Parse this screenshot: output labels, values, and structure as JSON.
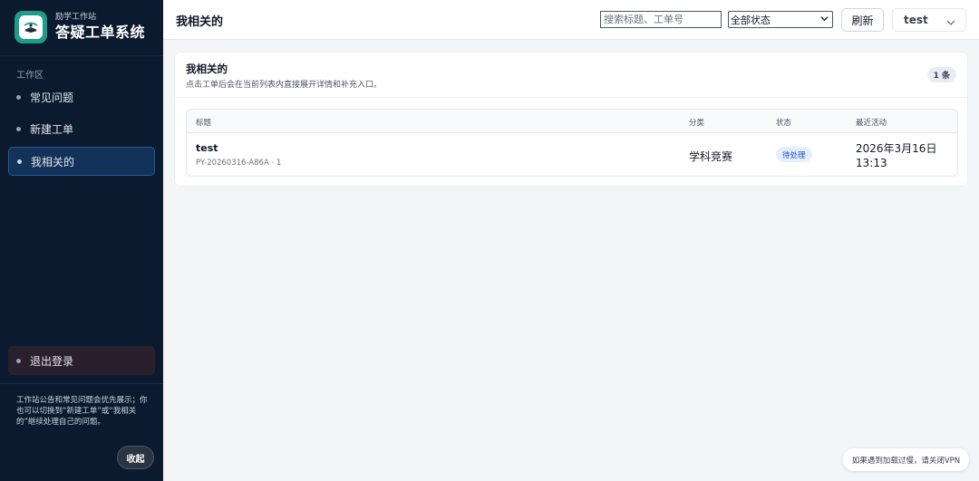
{
  "sidebar": {
    "brand_sub": "励学工作站",
    "brand_title": "答疑工单系统",
    "section_label": "工作区",
    "items": [
      {
        "label": "常见问题"
      },
      {
        "label": "新建工单"
      },
      {
        "label": "我相关的"
      }
    ],
    "logout_label": "退出登录",
    "note": "工作站公告和常见问题会优先展示；你也可以切换到“新建工单”或“我相关的”继续处理自己的问题。",
    "collapse_label": "收起"
  },
  "header": {
    "title": "我相关的",
    "search_placeholder": "搜索标题、工单号",
    "status_filter": "全部状态",
    "refresh_label": "刷新",
    "username": "test"
  },
  "main": {
    "card_title": "我相关的",
    "card_desc": "点击工单后会在当前列表内直接展开详情和补充入口。",
    "count_badge": "1 条",
    "columns": [
      "标题",
      "分类",
      "状态",
      "最近活动"
    ],
    "rows": [
      {
        "title": "test",
        "ticket_id": "PY-20260316-A86A · 1",
        "category": "学科竞赛",
        "status": "待处理",
        "last_activity": "2026年3月16日 13:13"
      }
    ]
  },
  "toast": "如果遇到加载过慢，请关闭VPN",
  "colors": {
    "sidebar_bg": "#0b1a2e",
    "active_item_bg": "#12325a",
    "logo_bg": "#1f9d8b",
    "status_pending_bg": "#e3f0fd",
    "status_pending_text": "#1d4ed8"
  },
  "icons": {
    "logo": "book-reading-logo-icon",
    "nav_bullet": "dot-icon",
    "dropdown": "chevron-down-icon"
  }
}
